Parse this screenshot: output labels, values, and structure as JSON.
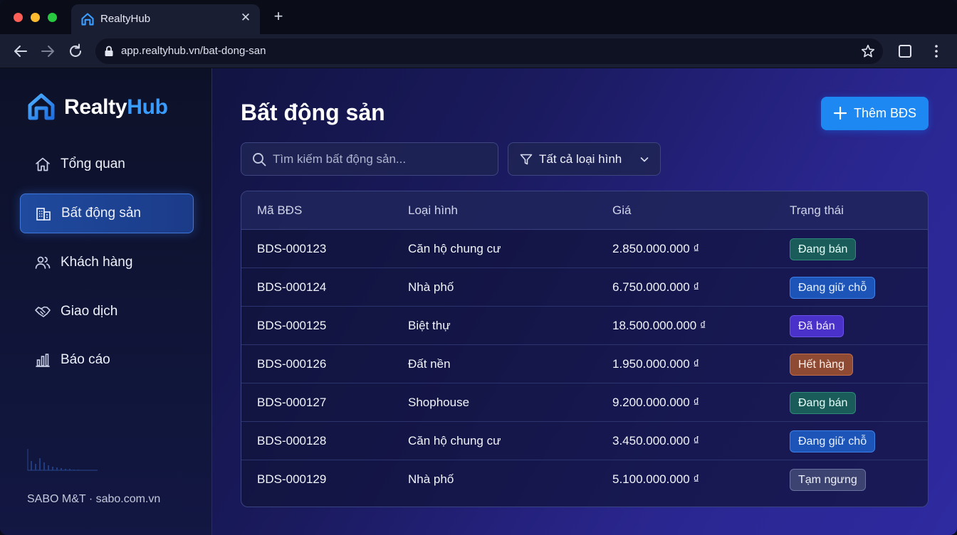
{
  "browser": {
    "tab_title": "RealtyHub",
    "url": "app.realtyhub.vn/bat-dong-san"
  },
  "sidebar": {
    "brand_part1": "Realty",
    "brand_part2": "Hub",
    "items": [
      {
        "label": "Tổng quan",
        "icon": "home-icon",
        "active": false
      },
      {
        "label": "Bất động sản",
        "icon": "building-icon",
        "active": true
      },
      {
        "label": "Khách hàng",
        "icon": "users-icon",
        "active": false
      },
      {
        "label": "Giao dịch",
        "icon": "handshake-icon",
        "active": false
      },
      {
        "label": "Báo cáo",
        "icon": "bar-chart-icon",
        "active": false
      }
    ],
    "footer": "SABO M&T · sabo.com.vn"
  },
  "main": {
    "title": "Bất động sản",
    "add_button": "Thêm BĐS",
    "search_placeholder": "Tìm kiếm bất động sản...",
    "filter_label": "Tất cả loại hình"
  },
  "table": {
    "headers": [
      "Mã BĐS",
      "Loại hình",
      "Giá",
      "Trạng thái"
    ],
    "rows": [
      {
        "code": "BDS-000123",
        "type": "Căn hộ chung cư",
        "price": "2.850.000.000 ₫",
        "status": "Đang bán"
      },
      {
        "code": "BDS-000124",
        "type": "Nhà phố",
        "price": "6.750.000.000 ₫",
        "status": "Đang giữ chỗ"
      },
      {
        "code": "BDS-000125",
        "type": "Biệt thự",
        "price": "18.500.000.000 ₫",
        "status": "Đã bán"
      },
      {
        "code": "BDS-000126",
        "type": "Đất nền",
        "price": "1.950.000.000 ₫",
        "status": "Hết hàng"
      },
      {
        "code": "BDS-000127",
        "type": "Shophouse",
        "price": "9.200.000.000 ₫",
        "status": "Đang bán"
      },
      {
        "code": "BDS-000128",
        "type": "Căn hộ chung cư",
        "price": "3.450.000.000 ₫",
        "status": "Đang giữ chỗ"
      },
      {
        "code": "BDS-000129",
        "type": "Nhà phố",
        "price": "5.100.000.000 ₫",
        "status": "Tạm ngưng"
      }
    ]
  },
  "colors": {
    "accent": "#1e88f2",
    "status_selling": "#1a5c5a",
    "status_reserved": "#1c54b8",
    "status_sold": "#4a31c9",
    "status_out": "#8e4a33",
    "status_paused": "#3c4370"
  }
}
